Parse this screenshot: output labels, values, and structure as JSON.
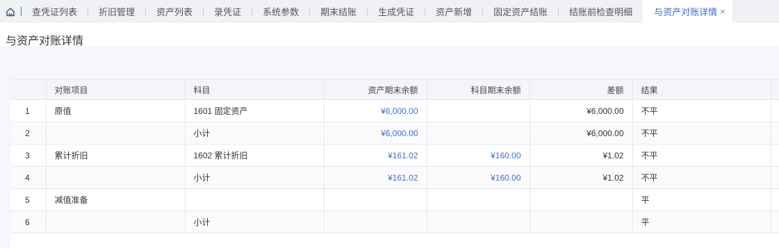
{
  "tabs": [
    {
      "label": "查凭证列表",
      "active": false
    },
    {
      "label": "折旧管理",
      "active": false
    },
    {
      "label": "资产列表",
      "active": false
    },
    {
      "label": "录凭证",
      "active": false
    },
    {
      "label": "系统参数",
      "active": false
    },
    {
      "label": "期末结账",
      "active": false
    },
    {
      "label": "生成凭证",
      "active": false
    },
    {
      "label": "资产新增",
      "active": false
    },
    {
      "label": "固定资产结账",
      "active": false
    },
    {
      "label": "结账前检查明细",
      "active": false
    },
    {
      "label": "与资产对账详情",
      "active": true
    }
  ],
  "tab_close_glyph": "×",
  "page_title": "与资产对账详情",
  "table": {
    "headers": {
      "index": "",
      "item": "对账项目",
      "subject": "科目",
      "asset_balance": "资产期末余额",
      "subject_balance": "科目期末余额",
      "difference": "差额",
      "result": "结果"
    },
    "rows": [
      {
        "index": "1",
        "item": "原值",
        "subject": "1601 固定资产",
        "asset_balance": "¥6,000.00",
        "subject_balance": "",
        "difference": "¥6,000.00",
        "result": "不平"
      },
      {
        "index": "2",
        "item": "",
        "subject": "小计",
        "asset_balance": "¥6,000.00",
        "subject_balance": "",
        "difference": "¥6,000.00",
        "result": "不平"
      },
      {
        "index": "3",
        "item": "累计折旧",
        "subject": "1602 累计折旧",
        "asset_balance": "¥161.02",
        "subject_balance": "¥160.00",
        "difference": "¥1.02",
        "result": "不平"
      },
      {
        "index": "4",
        "item": "",
        "subject": "小计",
        "asset_balance": "¥161.02",
        "subject_balance": "¥160.00",
        "difference": "¥1.02",
        "result": "不平"
      },
      {
        "index": "5",
        "item": "减值准备",
        "subject": "",
        "asset_balance": "",
        "subject_balance": "",
        "difference": "",
        "result": "平"
      },
      {
        "index": "6",
        "item": "",
        "subject": "小计",
        "asset_balance": "",
        "subject_balance": "",
        "difference": "",
        "result": "平"
      }
    ]
  },
  "colors": {
    "accent": "#3b6fd1",
    "tabbar_bg": "#f0f1f5",
    "header_bg": "#f3f5f9",
    "content_bg": "#f6f7fa"
  },
  "icons": {
    "home": "home-icon",
    "close": "close-icon"
  }
}
